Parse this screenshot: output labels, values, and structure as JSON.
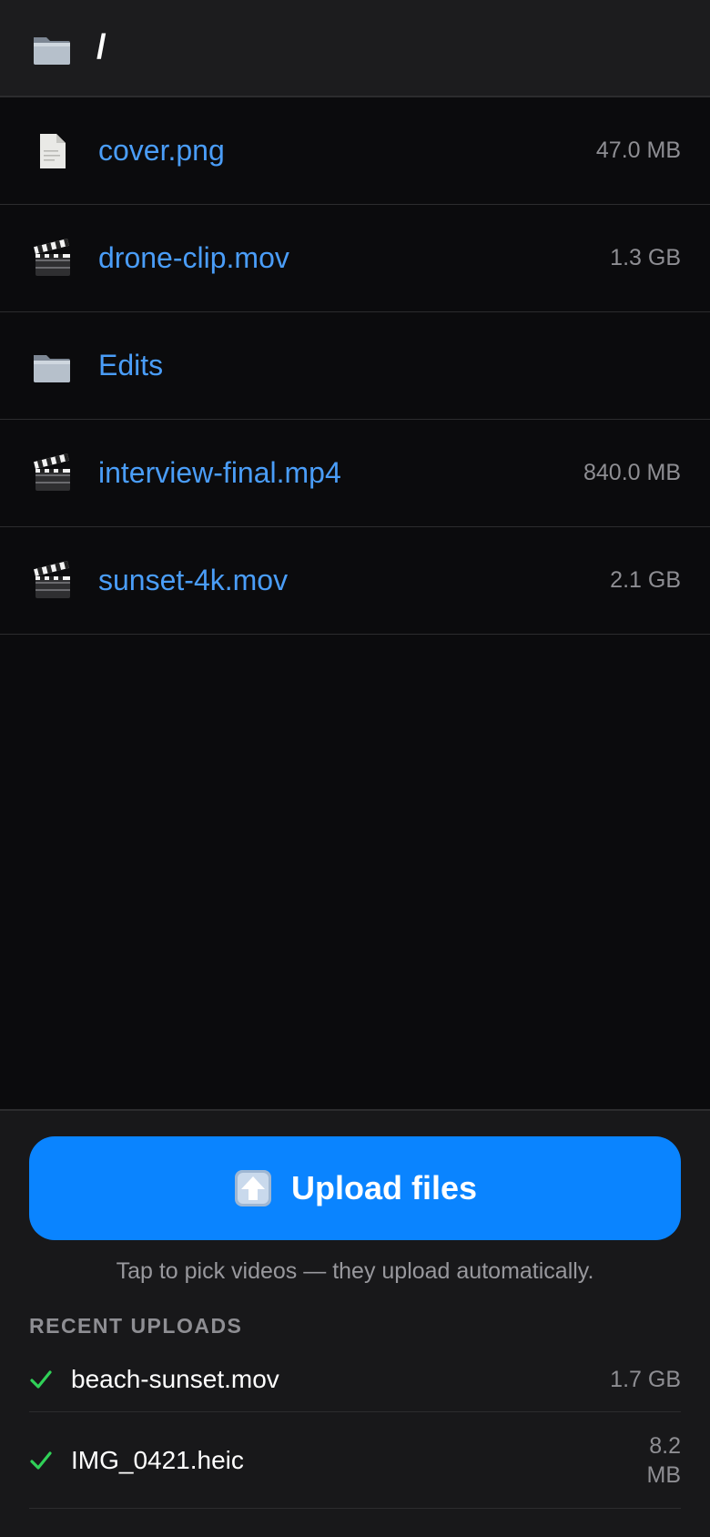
{
  "header": {
    "path": "/",
    "icon": "folder-icon"
  },
  "files": [
    {
      "name": "cover.png",
      "size": "47.0 MB",
      "icon": "document-icon"
    },
    {
      "name": "drone-clip.mov",
      "size": "1.3 GB",
      "icon": "clapperboard-icon"
    },
    {
      "name": "Edits",
      "size": "",
      "icon": "folder-icon"
    },
    {
      "name": "interview-final.mp4",
      "size": "840.0 MB",
      "icon": "clapperboard-icon"
    },
    {
      "name": "sunset-4k.mov",
      "size": "2.1 GB",
      "icon": "clapperboard-icon"
    }
  ],
  "upload": {
    "button_label": "Upload files",
    "icon": "upload-arrow-icon",
    "hint": "Tap to pick videos — they upload automatically."
  },
  "recent": {
    "title": "RECENT UPLOADS",
    "items": [
      {
        "name": "beach-sunset.mov",
        "size": "1.7 GB",
        "icon": "checkmark-icon"
      },
      {
        "name": "IMG_0421.heic",
        "size": "8.2 MB",
        "icon": "checkmark-icon"
      }
    ]
  },
  "colors": {
    "accent": "#0a84ff",
    "link": "#4a9df8",
    "success": "#30d158",
    "background": "#0b0b0d",
    "panel": "#18181a"
  }
}
